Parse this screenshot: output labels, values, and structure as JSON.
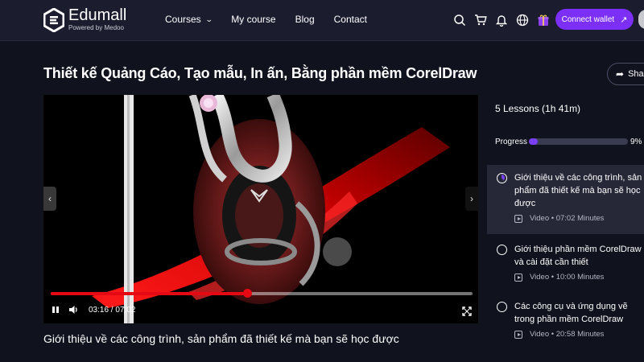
{
  "brand": {
    "name": "Edumall",
    "tagline": "Powered by Medoo"
  },
  "nav": {
    "courses": "Courses",
    "my_course": "My course",
    "blog": "Blog",
    "contact": "Contact"
  },
  "header_icons": [
    "search-icon",
    "cart-icon",
    "bell-icon",
    "globe-icon",
    "gift-icon"
  ],
  "wallet_button": "Connect wallet",
  "course_title": "Thiết kế Quảng Cáo, Tạo mẫu, In ấn, Bằng phần mềm CorelDraw",
  "share_label": "Shar",
  "player": {
    "current_time": "03:16",
    "total_time": "07:02",
    "time_display": "03:16 / 07:02",
    "progress_fraction": 0.465
  },
  "video_caption": "Giới thiệu về các công trình, sản phẩm đã thiết kế mà bạn sẽ học được",
  "sidebar": {
    "lessons_summary": "5 Lessons (1h 41m)",
    "progress_label": "Progress",
    "progress_percent": "9%",
    "progress_value": 9,
    "lessons": [
      {
        "title": "Giới thiệu về các công trình, sản phẩm đã thiết kế mà bạn sẽ học được",
        "meta": "Video • 07:02 Minutes",
        "active": true
      },
      {
        "title": "Giới thiệu phần mềm CorelDraw và cài đặt cần thiết",
        "meta": "Video • 10:00 Minutes",
        "active": false
      },
      {
        "title": "Các công cụ và ứng dụng vẽ trong phần mềm CorelDraw",
        "meta": "Video • 20:58 Minutes",
        "active": false
      }
    ]
  },
  "colors": {
    "accent": "#7b2ff7",
    "player_progress": "#e50914",
    "background": "#10131e",
    "topbar": "#1b1d2e"
  }
}
